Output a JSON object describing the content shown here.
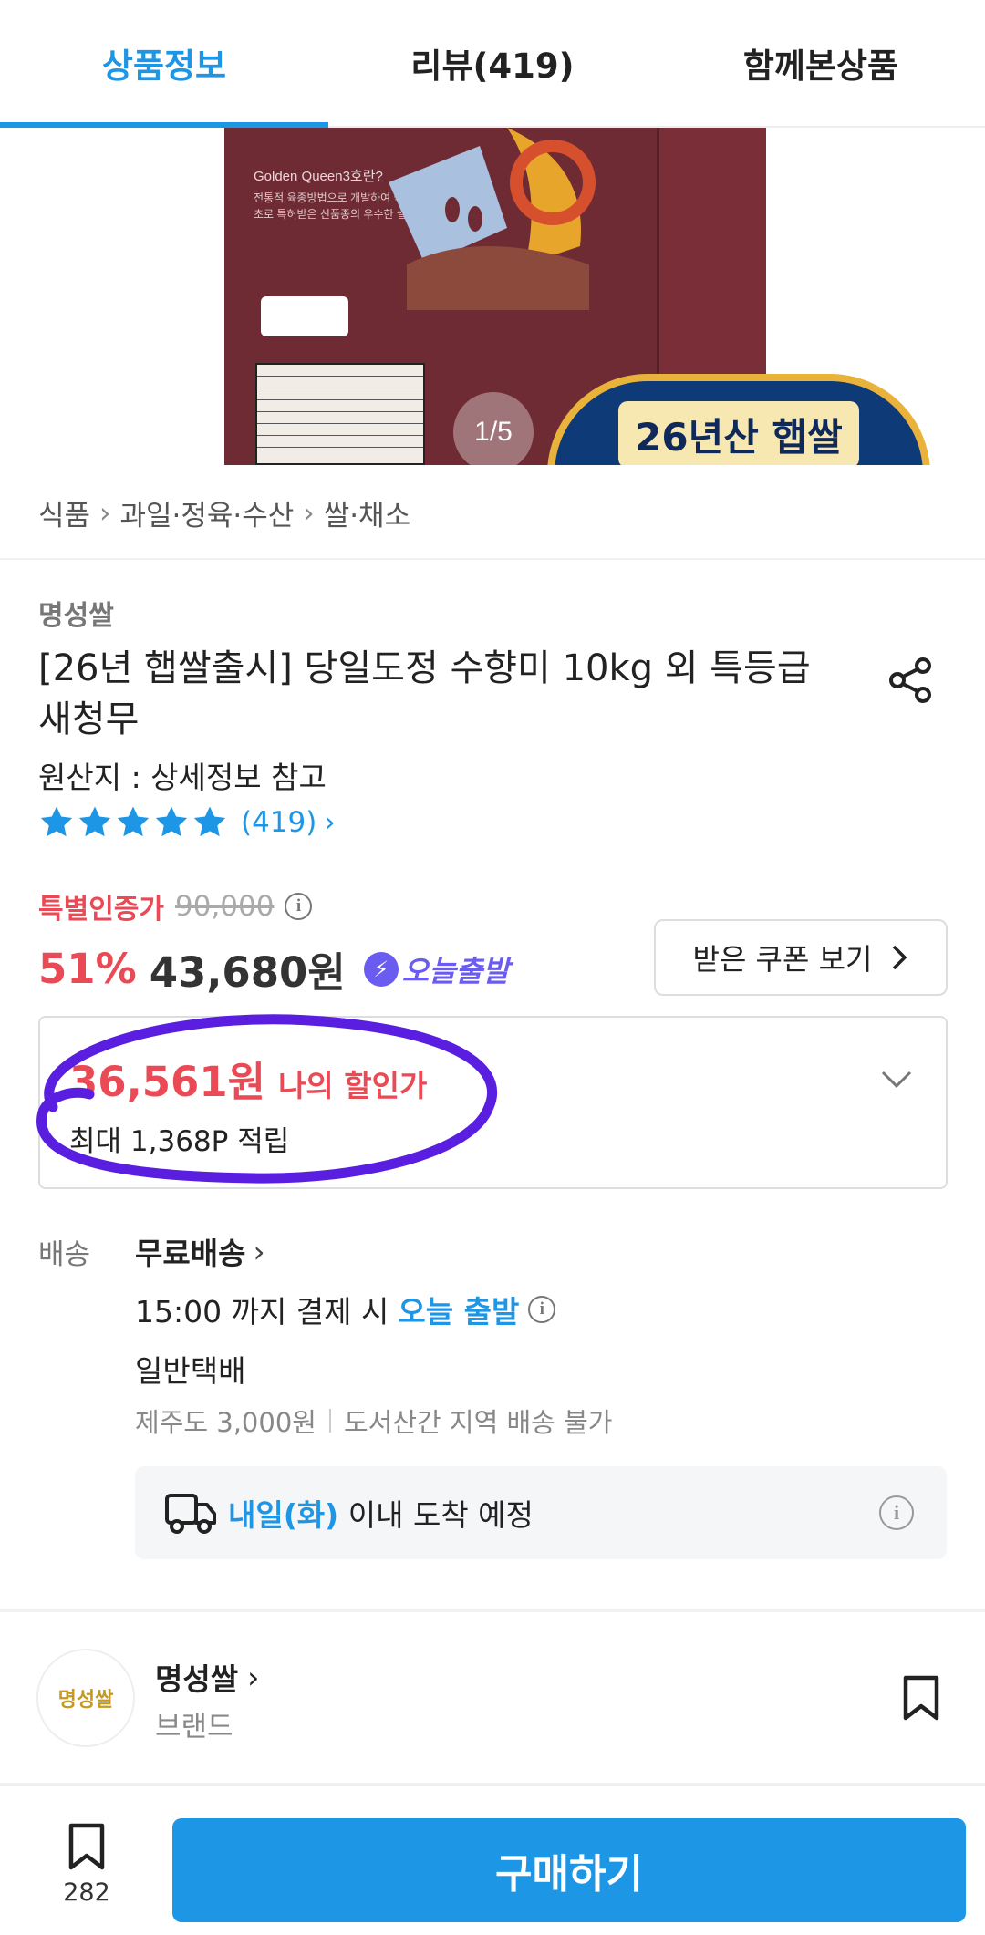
{
  "tabs": [
    {
      "label": "상품정보",
      "active": true
    },
    {
      "label": "리뷰(419)",
      "active": false
    },
    {
      "label": "함께본상품",
      "active": false
    }
  ],
  "hero": {
    "bag_text_title": "Golden Queen3호란?",
    "bag_text_body": "전통적 육종방법으로 개발하여 국내에서 최초로 특허받은 신품종의 우수한 쌀입니다.",
    "badge_text": "26년산 햅쌀",
    "pager": "1/5"
  },
  "breadcrumb": [
    "식품",
    "과일·정육·수산",
    "쌀·채소"
  ],
  "product": {
    "brand": "명성쌀",
    "title": "[26년 햅쌀출시] 당일도정 수향미 10kg 외 특등급 새청무",
    "origin": "원산지 : 상세정보 참고",
    "rating_stars": 5,
    "review_count": "(419)"
  },
  "pricing": {
    "special_label": "특별인증가",
    "original_price": "90,000",
    "discount_pct": "51%",
    "price": "43,680원",
    "today_badge": "오늘출발",
    "coupon_button": "받은 쿠폰 보기"
  },
  "my_discount": {
    "amount": "36,561원",
    "label": "나의 할인가",
    "points": "최대 1,368P 적립"
  },
  "shipping": {
    "label": "배송",
    "fee": "무료배송",
    "cutoff_prefix": "15:00 까지 결제 시",
    "cutoff_highlight": "오늘 출발",
    "method": "일반택배",
    "extra_fee": "제주도 3,000원",
    "restriction": "도서산간 지역 배송 불가",
    "arrival_highlight": "내일(화)",
    "arrival_suffix": "이내 도착 예정"
  },
  "store": {
    "logo_text": "명성쌀",
    "name": "명성쌀",
    "type": "브랜드"
  },
  "bottom_bar": {
    "save_count": "282",
    "buy_label": "구매하기"
  },
  "colors": {
    "accent": "#1e96e6",
    "sale_red": "#e94a55",
    "purple": "#6a5cf0"
  }
}
